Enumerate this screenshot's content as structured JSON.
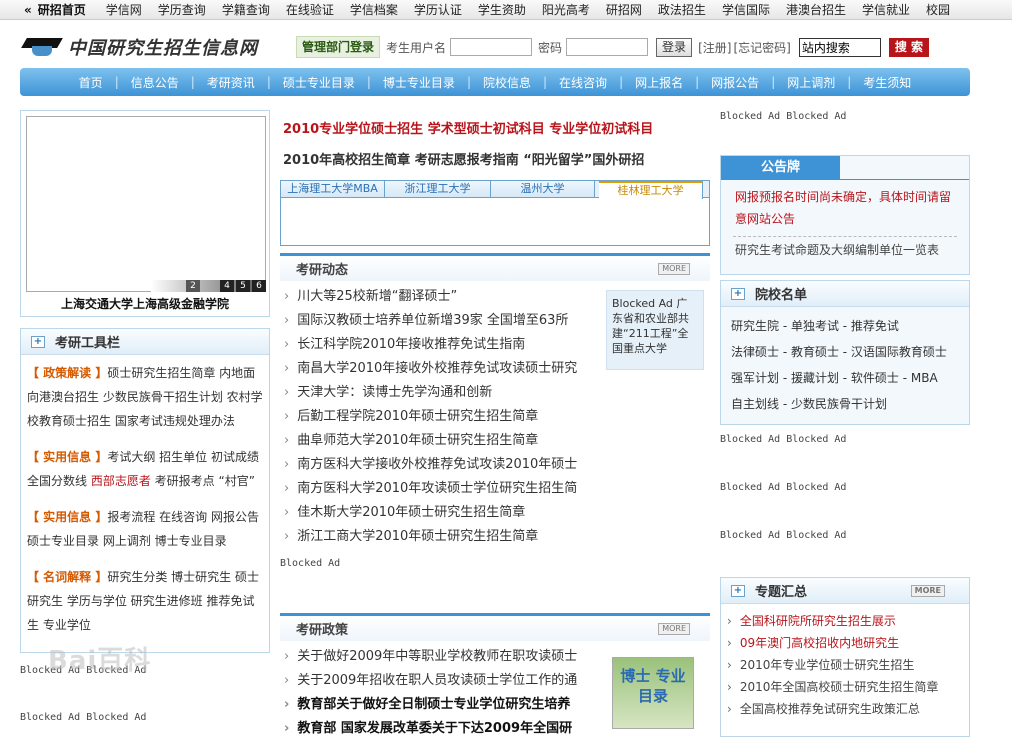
{
  "topbar": {
    "home": "研招首页",
    "links": [
      "学信网",
      "学历查询",
      "学籍查询",
      "在线验证",
      "学信档案",
      "学历认证",
      "学生资助",
      "阳光高考",
      "研招网",
      "政法招生",
      "学信国际",
      "港澳台招生",
      "学信就业",
      "校园"
    ]
  },
  "header": {
    "logo_text": "中国研究生招生信息网",
    "mgr_login": "管理部门登录",
    "user_label": "考生用户名",
    "pwd_label": "密码",
    "login_btn": "登录",
    "register": "[注册]",
    "forgot": "[忘记密码]",
    "search_value": "站内搜索",
    "search_btn": "搜 索"
  },
  "nav": [
    "首页",
    "信息公告",
    "考研资讯",
    "硕士专业目录",
    "博士专业目录",
    "院校信息",
    "在线咨询",
    "网上报名",
    "网报公告",
    "网上调剂",
    "考生须知"
  ],
  "left": {
    "image_caption": "上海交通大学上海高级金融学院",
    "slide_nums": [
      "2",
      "4",
      "5",
      "6"
    ],
    "tools_title": "考研工具栏",
    "tools": [
      {
        "tag": "【 政策解读 】",
        "text": "硕士研究生招生简章 内地面向港澳台招生 少数民族骨干招生计划 农村学校教育硕士招生 国家考试违规处理办法"
      },
      {
        "tag": "【 实用信息 】",
        "text": "考试大纲 招生单位 初试成绩 全国分数线 ",
        "red": "西部志愿者",
        "after": " 考研报考点 “村官”"
      },
      {
        "tag": "【 实用信息 】",
        "text": "报考流程 在线咨询 网报公告 硕士专业目录 网上调剂 博士专业目录"
      },
      {
        "tag": "【 名词解释 】",
        "text": "研究生分类 博士研究生 硕士研究生 学历与学位 研究生进修班 推荐免试生 专业学位"
      }
    ],
    "blocked1": "Blocked Ad Blocked Ad",
    "blocked2": "Blocked Ad Blocked Ad"
  },
  "center": {
    "feat_line1": "2010专业学位硕士招生  学术型硕士初试科目  专业学位初试科目",
    "feat_line2": "2010年高校招生简章  考研志愿报考指南  “阳光留学”国外研招",
    "tabs": [
      "上海理工大学MBA",
      "浙江理工大学",
      "温州大学",
      "桂林理工大学"
    ],
    "news_title": "考研动态",
    "more": "MORE",
    "news": [
      "川大等25校新增“翻译硕士”",
      "国际汉教硕士培养单位新增39家 全国增至63所",
      "长江科学院2010年接收推荐免试生指南",
      "南昌大学2010年接收外校推荐免试攻读硕士研究",
      "天津大学：读博士先学沟通和创新",
      "后勤工程学院2010年硕士研究生招生简章",
      "曲阜师范大学2010年硕士研究生招生简章",
      "南方医科大学接收外校推荐免试攻读2010年硕士",
      "南方医科大学2010年攻读硕士学位研究生招生简",
      "佳木斯大学2010年硕士研究生招生简章",
      "浙江工商大学2010年硕士研究生招生简章"
    ],
    "side_ad": "Blocked Ad 广东省和农业部共建“211工程”全国重点大学",
    "blocked": "Blocked Ad",
    "policy_title": "考研政策",
    "policy": [
      {
        "text": "关于做好2009年中等职业学校教师在职攻读硕士",
        "bold": false
      },
      {
        "text": "关于2009年招收在职人员攻读硕士学位工作的通",
        "bold": false
      },
      {
        "text": "教育部关于做好全日制硕士专业学位研究生培养",
        "bold": true
      },
      {
        "text": "教育部 国家发展改革委关于下达2009年全国研",
        "bold": true
      }
    ],
    "book_text": "博士 专业目录"
  },
  "right": {
    "blocked_top": "Blocked Ad Blocked Ad",
    "notice_title": "公告牌",
    "notice_red": "网报预报名时间尚未确定，具体时间请留意网站公告",
    "notice_plain": "研究生考试命题及大纲编制单位一览表",
    "schools_title": "院校名单",
    "schools_rows": [
      "研究生院 - 单独考试 - 推荐免试",
      "法律硕士 - 教育硕士 - 汉语国际教育硕士",
      "强军计划 - 援藏计划 - 软件硕士 - MBA",
      "自主划线 - 少数民族骨干计划"
    ],
    "blocked_rows": [
      "Blocked Ad Blocked Ad",
      "Blocked Ad Blocked Ad",
      "Blocked Ad Blocked Ad"
    ],
    "topics_title": "专题汇总",
    "topics": [
      {
        "text": "全国科研院所研究生招生展示",
        "red": true
      },
      {
        "text": "09年澳门高校招收内地研究生",
        "red": true
      },
      {
        "text": "2010年专业学位硕士研究生招生",
        "red": false
      },
      {
        "text": "2010年全国高校硕士研究生招生简章",
        "red": false
      },
      {
        "text": "全国高校推荐免试研究生政策汇总",
        "red": false
      }
    ]
  },
  "watermark": "Bai百科"
}
